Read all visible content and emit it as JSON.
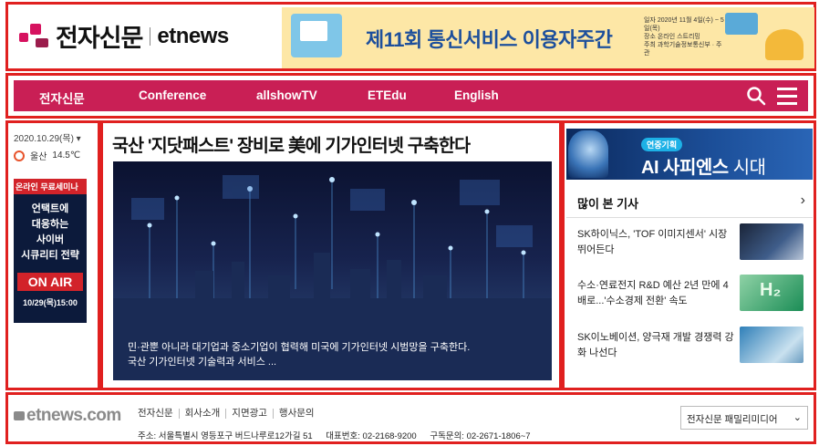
{
  "header": {
    "logo_kr": "전자신문",
    "logo_en": "etnews",
    "banner": {
      "title": "제11회 통신서비스 이용자주간",
      "date_line1": "일자 2020년 11월 4일(수) ~ 5일(목)",
      "date_line2": "장소 온라인 스트리밍",
      "date_line3": "주최 과학기술정보통신부 · 주관"
    }
  },
  "nav": {
    "items": [
      "전자신문",
      "Conference",
      "allshowTV",
      "ETEdu",
      "English"
    ],
    "icons": [
      "search-icon",
      "menu-icon"
    ]
  },
  "left": {
    "date": "2020.10.29(목) ▾",
    "weather_city": "울산",
    "weather_temp": "14.5℃",
    "promo": {
      "tag": "온라인 무료세미나",
      "line1": "언택트에",
      "line2": "대응하는",
      "line3": "사이버",
      "line4": "시큐리티 전략",
      "air": "ON AIR",
      "time": "10/29(목)15:00"
    }
  },
  "main": {
    "headline": "국산 '지닷패스트' 장비로 美에 기가인터넷 구축한다",
    "caption_line1": "민·관뿐 아니라 대기업과 중소기업이 협력해 미국에 기가인터넷 시범망을 구축한다.",
    "caption_line2": "국산 기가인터넷 기술력과 서비스 ..."
  },
  "right": {
    "ai_banner": {
      "tag": "연중기획",
      "title_bold": "AI 사피엔스",
      "title_light": " 시대"
    },
    "popular_title": "많이 본 기사",
    "popular": [
      {
        "text": "SK하이닉스, 'TOF 이미지센서' 시장 뛰어든다"
      },
      {
        "text": "수소·연료전지 R&D 예산 2년 만에 4배로...'수소경제 전환' 속도"
      },
      {
        "text": "SK이노베이션, 양극재 개발 경쟁력 강화 나선다"
      }
    ]
  },
  "footer": {
    "logo": "etnews.com",
    "links": [
      "전자신문",
      "회사소개",
      "지면광고",
      "행사문의"
    ],
    "address_label": "주소: 서울특별시 영등포구 버드나루로12가길 51",
    "phone": "대표번호: 02-2168-9200",
    "subscribe": "구독문의: 02-2671-1806~7",
    "family_select": "전자신문 패밀리미디어"
  },
  "colors": {
    "accent": "#c91f55",
    "outline": "#e0201f"
  }
}
